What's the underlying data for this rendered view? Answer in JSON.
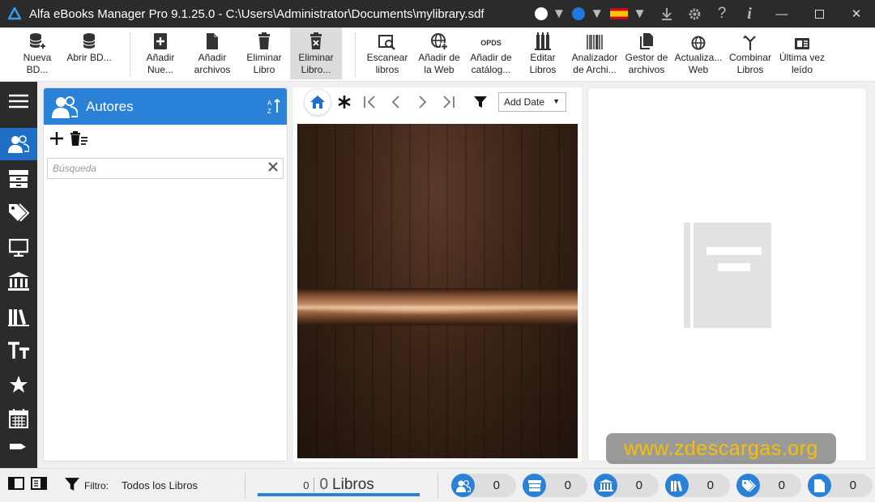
{
  "window": {
    "title": "Alfa eBooks Manager Pro 9.1.25.0 - C:\\Users\\Administrator\\Documents\\mylibrary.sdf",
    "colors": {
      "titlebar": "#2b2b2b",
      "accent": "#2a82d8",
      "flag": "spain-flag"
    }
  },
  "ribbon": {
    "new_db": "Nueva\nBD...",
    "open_db": "Abrir BD...",
    "add_book": "Añadir\nNue...",
    "add_files": "Añadir\narchivos",
    "delete_book": "Eliminar\nLibro",
    "delete_book2": "Eliminar\nLibro...",
    "scan_books": "Escanear\nlibros",
    "add_web": "Añadir de\nla Web",
    "opds_badge": "OPDS",
    "add_catalog": "Añadir de\ncatálog...",
    "edit_books": "Editar\nLibros",
    "file_analyzer": "Analizador\nde Archi...",
    "file_manager": "Gestor de\narchivos",
    "update_web": "Actualiza...\nWeb",
    "combine_books": "Combinar\nLibros",
    "last_read": "Última vez\nleído"
  },
  "authors_panel": {
    "title": "Autores",
    "search_placeholder": "Búsqueda"
  },
  "books_toolbar": {
    "sort_value": "Add Date"
  },
  "watermark": "www.zdescargas.org",
  "statusbar": {
    "filter_label": "Filtro:",
    "filter_value": "Todos los Libros",
    "selected_count": "0",
    "total_count": "0",
    "books_label": "Libros",
    "counters": [
      {
        "icon": "authors-icon",
        "value": "0"
      },
      {
        "icon": "archive-icon",
        "value": "0"
      },
      {
        "icon": "library-icon",
        "value": "0"
      },
      {
        "icon": "books-icon",
        "value": "0"
      },
      {
        "icon": "tags-icon",
        "value": "0"
      },
      {
        "icon": "file-icon",
        "value": "0"
      }
    ]
  }
}
